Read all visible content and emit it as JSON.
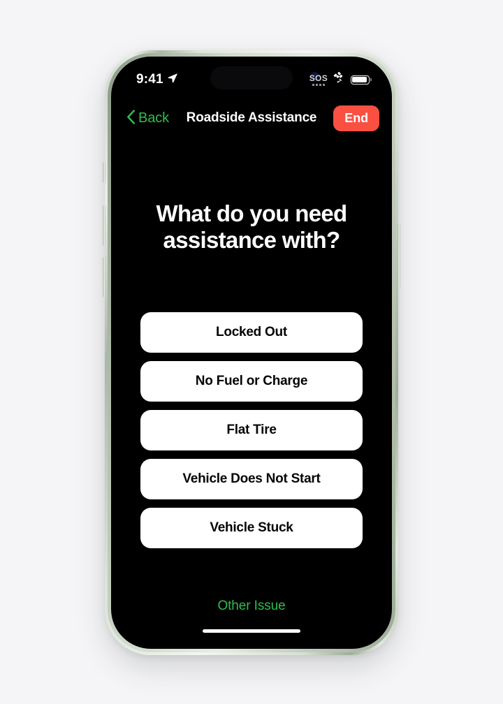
{
  "device": {
    "frame_color": "#d7e0d3",
    "screen_background": "#000000"
  },
  "status_bar": {
    "time": "9:41",
    "location_icon": "location-arrow-icon",
    "sos_label": "SOS",
    "satellite_icon": "satellite-icon",
    "battery_icon": "battery-full-icon"
  },
  "nav_bar": {
    "back_icon": "chevron-left-icon",
    "back_label": "Back",
    "title": "Roadside Assistance",
    "end_label": "End",
    "end_color": "#fa5042",
    "accent_color": "#2fbe4f"
  },
  "main": {
    "headline": "What do you need assistance with?",
    "options": [
      {
        "label": "Locked Out"
      },
      {
        "label": "No Fuel or Charge"
      },
      {
        "label": "Flat Tire"
      },
      {
        "label": "Vehicle Does Not Start"
      },
      {
        "label": "Vehicle Stuck"
      }
    ],
    "other_issue_label": "Other Issue"
  }
}
